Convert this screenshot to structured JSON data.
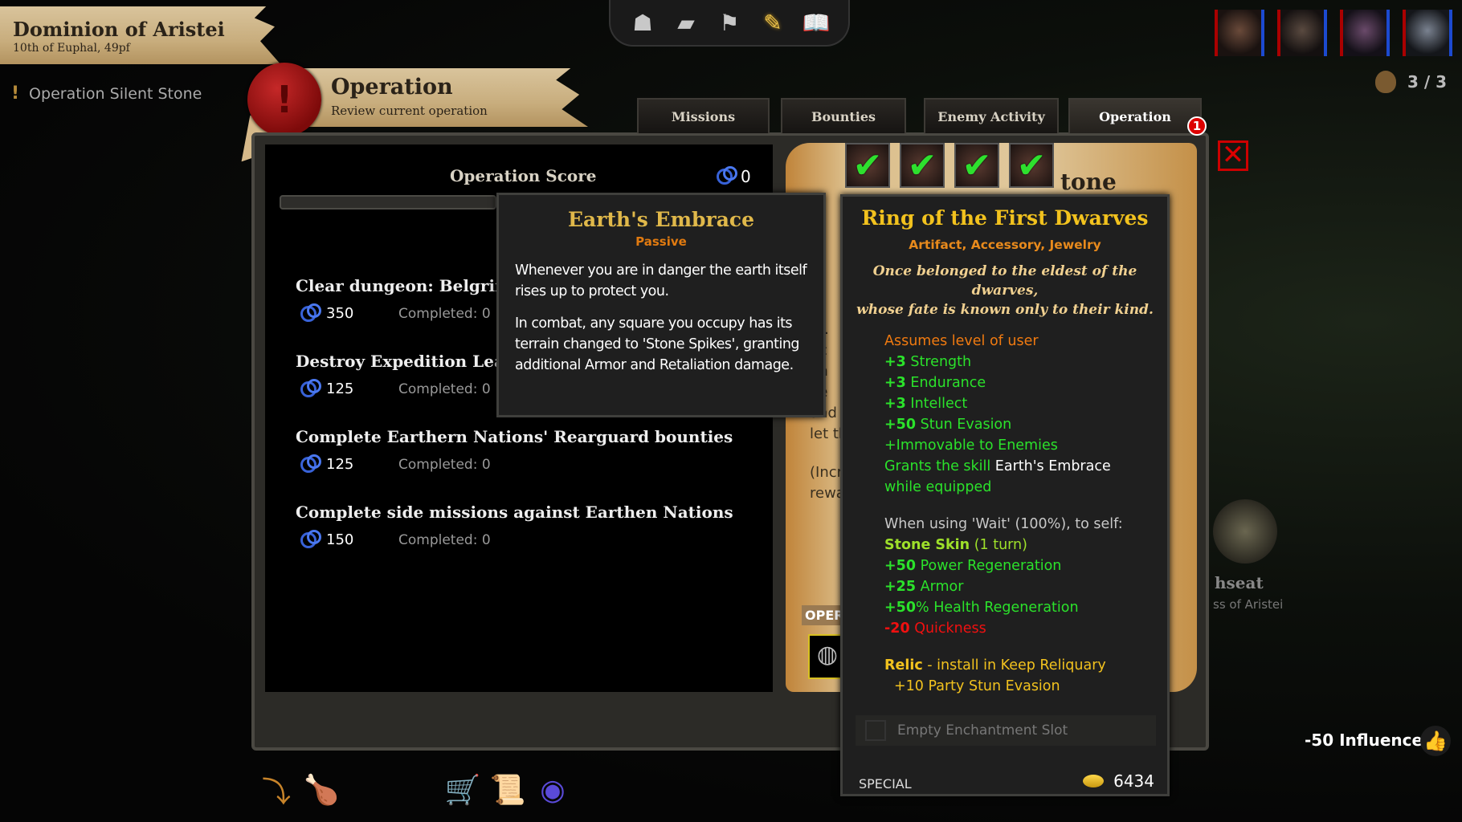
{
  "header": {
    "realm": "Dominion of Aristei",
    "date": "10th of Euphal, 49pf"
  },
  "sidebar": {
    "items": [
      {
        "label": "Operation Silent Stone",
        "icon": "exclamation-icon"
      }
    ]
  },
  "section_banner": {
    "title": "Operation",
    "subtitle": "Review current operation",
    "seal_icon": "!"
  },
  "topbar": {
    "icons": [
      "hood-icon",
      "satchel-icon",
      "flag-icon",
      "quest-scroll-icon",
      "book-icon"
    ],
    "active_index": 3
  },
  "party": {
    "portraits": [
      "warrior-portrait",
      "rogue-portrait",
      "mage-portrait",
      "armored-portrait"
    ],
    "bag": "3 / 3"
  },
  "tabs": [
    {
      "label": "Missions"
    },
    {
      "label": "Bounties"
    },
    {
      "label": "Enemy Activity"
    },
    {
      "label": "Operation",
      "active": true
    }
  ],
  "tab_badge": "1",
  "operation": {
    "score_label": "Operation Score",
    "score": "0",
    "objectives": [
      {
        "title": "Clear dungeon: Belgrin",
        "points": "350",
        "completed": "Completed: 0"
      },
      {
        "title": "Destroy Expedition Lea",
        "points": "125",
        "completed": "Completed: 0"
      },
      {
        "title": "Complete Earthern Nations' Rearguard bounties",
        "points": "125",
        "completed": "Completed: 0"
      },
      {
        "title": "Complete side missions against Earthen Nations",
        "points": "150",
        "completed": "Completed: 0"
      }
    ]
  },
  "parchment": {
    "title_fragment": "tone",
    "fragments": [
      "c",
      "ot",
      "",
      "rh",
      "et.",
      "tic",
      "nn",
      "he",
      "and",
      "let th",
      "",
      "(Incr",
      "rewa"
    ],
    "oper_label": "OPER",
    "checks": [
      "✔",
      "✔",
      "✔",
      "✔"
    ]
  },
  "skill_tooltip": {
    "title": "Earth's Embrace",
    "type": "Passive",
    "desc1": "Whenever you are in danger the earth itself rises up to protect you.",
    "desc2": "In combat, any square you occupy has its terrain changed to 'Stone Spikes', granting additional Armor and Retaliation damage."
  },
  "item_tooltip": {
    "title": "Ring of the First Dwarves",
    "categories": "Artifact, Accessory, Jewelry",
    "flavor1": "Once belonged to the eldest of the dwarves,",
    "flavor2": "whose fate is known only to their kind.",
    "assumes": "Assumes level of user",
    "stats": [
      {
        "v": "+3",
        "n": " Strength"
      },
      {
        "v": "+3",
        "n": " Endurance"
      },
      {
        "v": "+3",
        "n": " Intellect"
      },
      {
        "v": "+50",
        "n": " Stun Evasion"
      }
    ],
    "immovable": "+Immovable to Enemies",
    "grants_pre": "Grants the skill ",
    "grants_skill": "Earth's Embrace",
    "grants_post": "while equipped",
    "wait": "When using 'Wait' (100%), to self:",
    "effect_name": "Stone Skin",
    "effect_dur": " (1 turn)",
    "effect_stats": [
      {
        "v": "+50",
        "n": " Power Regeneration"
      },
      {
        "v": "+25",
        "n": " Armor"
      },
      {
        "v": "+50",
        "n": "% Health Regeneration"
      }
    ],
    "penalty_v": "-20",
    "penalty_n": " Quickness",
    "relic": "Relic",
    "relic_text": " - install in Keep Reliquary",
    "relic_bonus": "+10 Party Stun Evasion",
    "enchant": "Empty Enchantment Slot",
    "rarity": "SPECIAL",
    "value": "6434"
  },
  "map": {
    "site_name": "hseat",
    "site_owner": "ss of Aristei"
  },
  "influence": "-50 Influence",
  "bottom_icons": [
    "return-icon",
    "ration-icon",
    "supply-cart-icon",
    "scroll-icon",
    "orb-icon"
  ],
  "colors": {
    "gold_title": "#f2c21e",
    "bonus_green": "#2be22b",
    "penalty_red": "#f01010",
    "category_orange": "#e88a1c",
    "score_ring": "#3862d8"
  }
}
